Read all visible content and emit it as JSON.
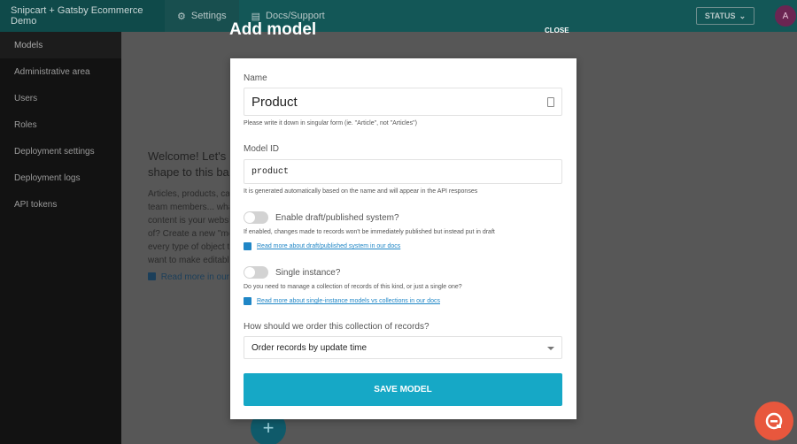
{
  "topbar": {
    "project": "Snipcart + Gatsby Ecommerce Demo",
    "nav": [
      {
        "label": "Settings",
        "icon": "gear-icon"
      },
      {
        "label": "Docs/Support",
        "icon": "document-icon"
      }
    ],
    "status_label": "STATUS",
    "avatar_initial": "A"
  },
  "sidebar": {
    "items": [
      {
        "label": "Models"
      },
      {
        "label": "Administrative area"
      },
      {
        "label": "Users"
      },
      {
        "label": "Roles"
      },
      {
        "label": "Deployment settings"
      },
      {
        "label": "Deployment logs"
      },
      {
        "label": "API tokens"
      }
    ]
  },
  "background": {
    "welcome_title_1": "Welcome! Let's g",
    "welcome_title_2": "shape to this bac",
    "welcome_lines": [
      "Articles, products, ca",
      "team members... wha",
      "content is your websi",
      "of? Create a new \"mo",
      "every type of object th",
      "want to make editabl"
    ],
    "welcome_link": "Read more in our"
  },
  "modal": {
    "title": "Add model",
    "close_label": "CLOSE",
    "name_label": "Name",
    "name_value": "Product",
    "name_hint": "Please write it down in singular form (ie. \"Article\", not \"Articles\")",
    "model_id_label": "Model ID",
    "model_id_value": "product",
    "model_id_hint": "It is generated automatically based on the name and will appear in the API responses",
    "draft_label": "Enable draft/published system?",
    "draft_hint": "If enabled, changes made to records won't be immediately published but instead put in draft",
    "draft_link": "Read more about draft/published system in our docs",
    "single_label": "Single instance?",
    "single_hint": "Do you need to manage a collection of records of this kind, or just a single one?",
    "single_link": "Read more about single-instance models vs collections in our docs",
    "order_label": "How should we order this collection of records?",
    "order_value": "Order records by update time",
    "save_label": "SAVE MODEL"
  },
  "colors": {
    "topbar": "#135757",
    "accent": "#16a8c6",
    "link": "#1f86c6",
    "chat": "#e8573d"
  }
}
